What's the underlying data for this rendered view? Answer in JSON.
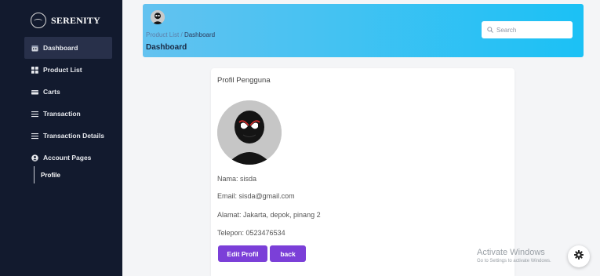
{
  "brand": {
    "name": "SERENITY"
  },
  "sidebar": {
    "items": [
      {
        "label": "Dashboard",
        "icon": "calendar-icon",
        "active": true
      },
      {
        "label": "Product List",
        "icon": "grid-icon"
      },
      {
        "label": "Carts",
        "icon": "cart-icon"
      },
      {
        "label": "Transaction",
        "icon": "list-icon"
      },
      {
        "label": "Transaction Details",
        "icon": "list-icon"
      },
      {
        "label": "Account Pages",
        "icon": "user-circle-icon"
      }
    ],
    "sub_item": "Profile"
  },
  "header": {
    "breadcrumb_parent": "Product List",
    "breadcrumb_separator": "/",
    "breadcrumb_current": "Dashboard",
    "title": "Dashboard",
    "search_placeholder": "Search"
  },
  "profile": {
    "title": "Profil Pengguna",
    "name": "Nama: sisda",
    "email": "Email: sisda@gmail.com",
    "address": "Alamat: Jakarta, depok, pinang 2",
    "phone": "Telepon: 0523476534",
    "edit_label": "Edit Profil",
    "back_label": "back"
  },
  "watermark": {
    "title": "Activate Windows",
    "subtitle": "Go to Settings to activate Windows."
  },
  "colors": {
    "sidebar_bg": "#121a2e",
    "header_gradient_start": "#63c2f0",
    "header_gradient_end": "#1bc1f5",
    "button": "#7b3fd8"
  }
}
